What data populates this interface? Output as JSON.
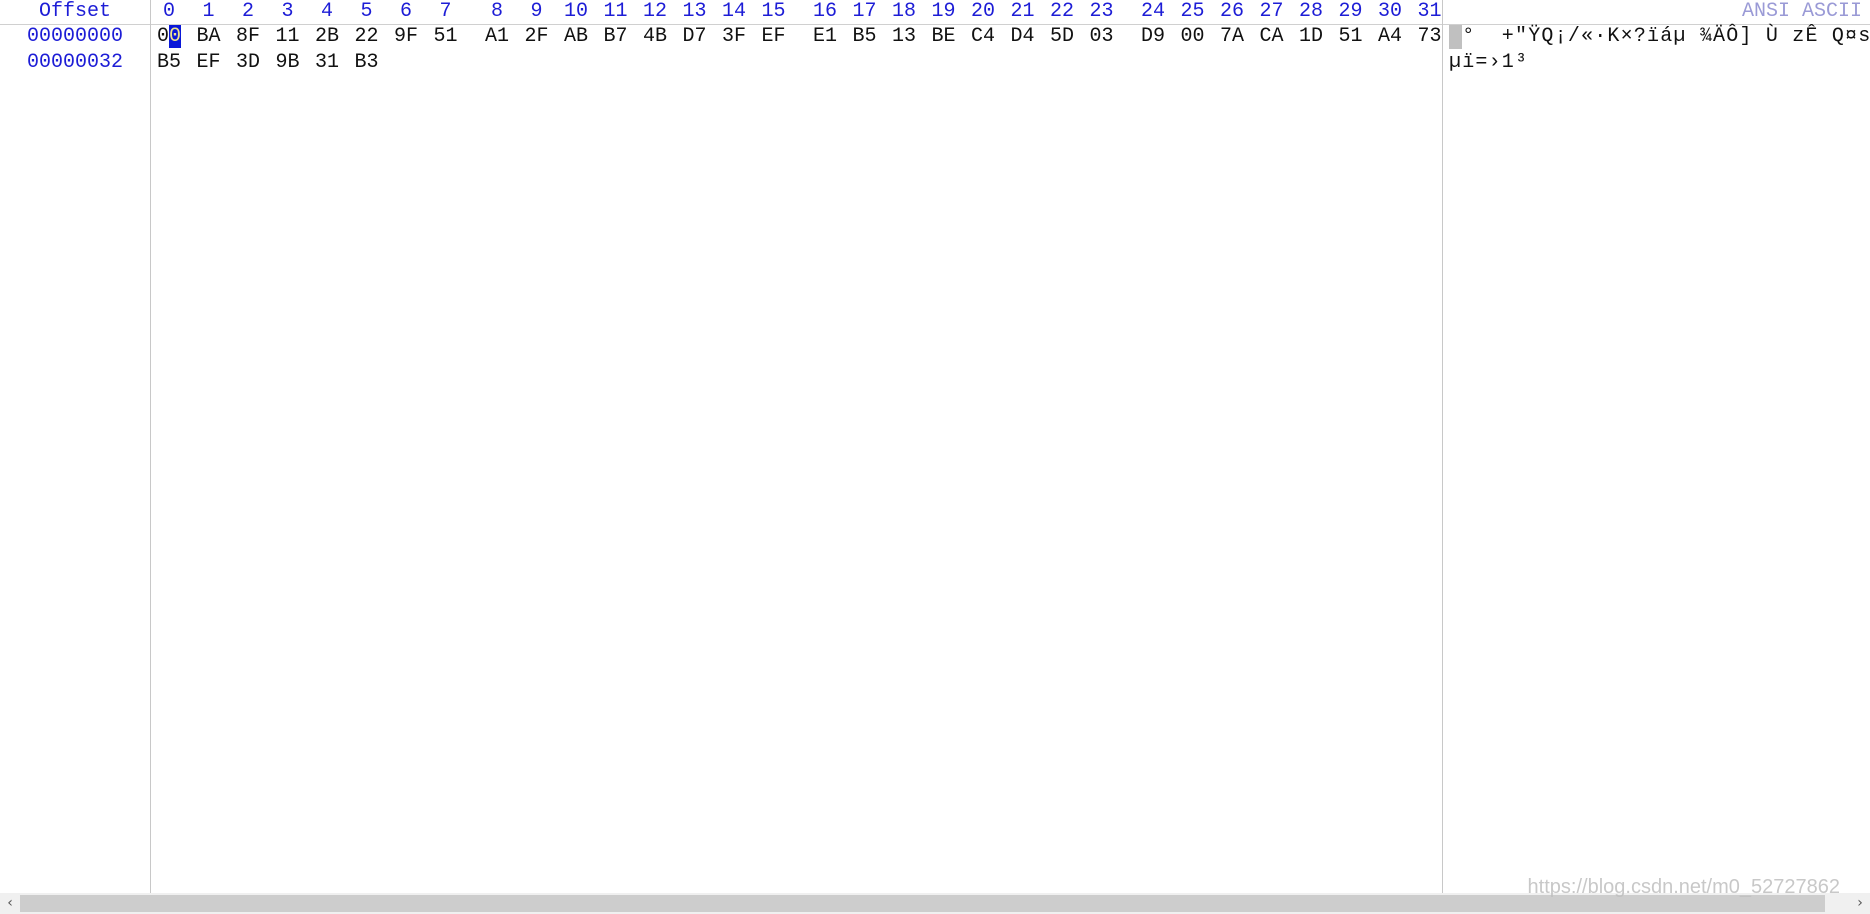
{
  "header": {
    "offset_label": "Offset",
    "columns": [
      "0",
      "1",
      "2",
      "3",
      "4",
      "5",
      "6",
      "7",
      "8",
      "9",
      "10",
      "11",
      "12",
      "13",
      "14",
      "15",
      "16",
      "17",
      "18",
      "19",
      "20",
      "21",
      "22",
      "23",
      "24",
      "25",
      "26",
      "27",
      "28",
      "29",
      "30",
      "31"
    ],
    "ascii_label": "ANSI ASCII"
  },
  "rows": [
    {
      "offset": "00000000",
      "bytes": [
        "00",
        "BA",
        "8F",
        "11",
        "2B",
        "22",
        "9F",
        "51",
        "A1",
        "2F",
        "AB",
        "B7",
        "4B",
        "D7",
        "3F",
        "EF",
        "E1",
        "B5",
        "13",
        "BE",
        "C4",
        "D4",
        "5D",
        "03",
        "D9",
        "00",
        "7A",
        "CA",
        "1D",
        "51",
        "A4",
        "73"
      ],
      "ascii": " °  +\"ŸQ¡/«·K×?ïáµ ¾ÄÔ] Ù zÊ Q¤s"
    },
    {
      "offset": "00000032",
      "bytes": [
        "B5",
        "EF",
        "3D",
        "9B",
        "31",
        "B3"
      ],
      "ascii": "µï=›1³"
    }
  ],
  "cursor": {
    "row": 0,
    "col": 0
  },
  "colors": {
    "header_text": "#1d1dd6",
    "ascii_label": "#9a9ad6",
    "cursor": "#0a18d8"
  },
  "scrollbar": {
    "left_icon": "chevron-left-icon",
    "right_icon": "chevron-right-icon",
    "left_glyph": "‹",
    "right_glyph": "›"
  },
  "watermark": "https://blog.csdn.net/m0_52727862"
}
